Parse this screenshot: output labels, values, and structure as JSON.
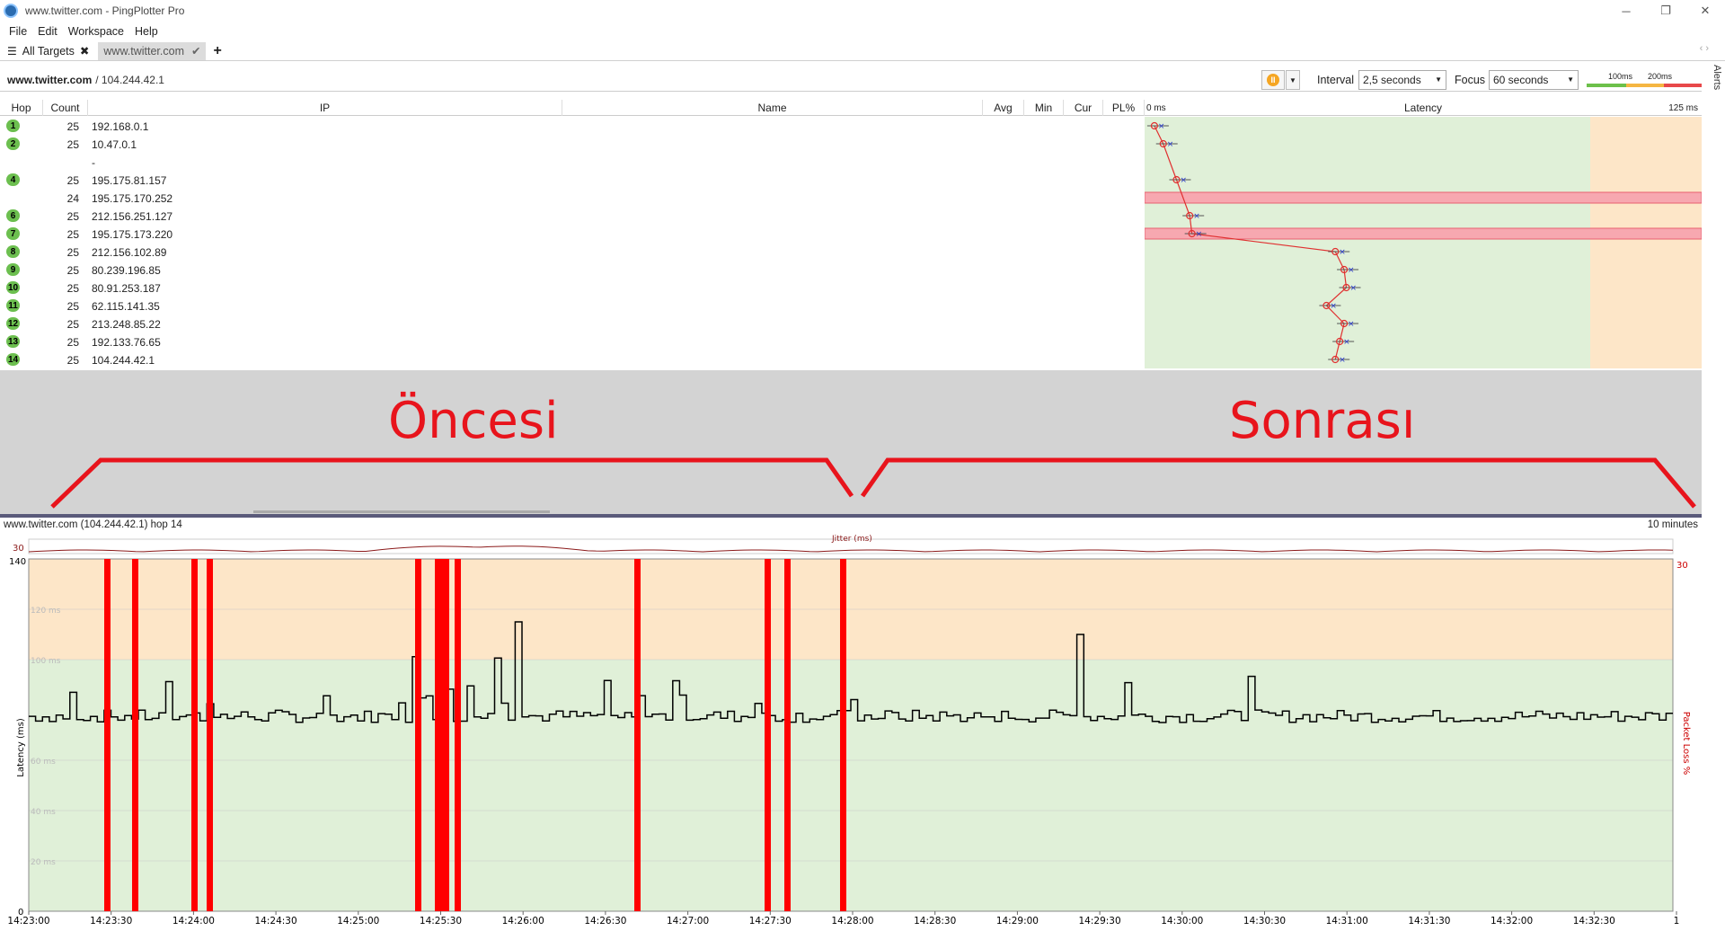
{
  "window": {
    "title": "www.twitter.com - PingPlotter Pro",
    "controls": [
      "─",
      "❐",
      "✕"
    ]
  },
  "menu": [
    "File",
    "Edit",
    "Workspace",
    "Help"
  ],
  "tabs": {
    "all_targets": "All Targets",
    "active": "www.twitter.com"
  },
  "toolbar": {
    "target_name": "www.twitter.com",
    "target_ip": "/ 104.244.42.1",
    "interval_label": "Interval",
    "interval_value": "2,5 seconds",
    "focus_label": "Focus",
    "focus_value": "60 seconds",
    "legend_100": "100ms",
    "legend_200": "200ms",
    "alerts": "Alerts"
  },
  "table": {
    "headers": [
      "Hop",
      "Count",
      "IP",
      "Name",
      "Avg",
      "Min",
      "Cur",
      "PL%"
    ],
    "latency_header": "Latency",
    "latency_min": "0 ms",
    "latency_max": "125 ms",
    "rows": [
      {
        "hop": "1",
        "count": "25",
        "ip": "192.168.0.1"
      },
      {
        "hop": "2",
        "count": "25",
        "ip": "10.47.0.1"
      },
      {
        "hop": "",
        "count": "",
        "ip": "-"
      },
      {
        "hop": "4",
        "count": "25",
        "ip": "195.175.81.157"
      },
      {
        "hop": "",
        "count": "24",
        "ip": "195.175.170.252"
      },
      {
        "hop": "6",
        "count": "25",
        "ip": "212.156.251.127"
      },
      {
        "hop": "7",
        "count": "25",
        "ip": "195.175.173.220"
      },
      {
        "hop": "8",
        "count": "25",
        "ip": "212.156.102.89"
      },
      {
        "hop": "9",
        "count": "25",
        "ip": "80.239.196.85"
      },
      {
        "hop": "10",
        "count": "25",
        "ip": "80.91.253.187"
      },
      {
        "hop": "11",
        "count": "25",
        "ip": "62.115.141.35"
      },
      {
        "hop": "12",
        "count": "25",
        "ip": "213.248.85.22"
      },
      {
        "hop": "13",
        "count": "25",
        "ip": "192.133.76.65"
      },
      {
        "hop": "14",
        "count": "25",
        "ip": "104.244.42.1"
      },
      {
        "hop": "",
        "count": "25",
        "ip": ""
      }
    ],
    "hop_latency_ms": [
      1,
      3,
      null,
      6,
      null,
      9,
      9.5,
      42,
      44,
      44.5,
      40,
      44,
      43,
      42
    ],
    "hop_lossy_rows": [
      4,
      6
    ]
  },
  "annotations": {
    "before": "Öncesi",
    "after": "Sonrası"
  },
  "graph": {
    "title": "www.twitter.com (104.244.42.1) hop 14",
    "range": "10 minutes",
    "jitter_label": "Jitter (ms)",
    "jitter_max": "30",
    "y_axis_label": "Latency (ms)",
    "y2_axis_label": "Packet Loss %",
    "y_max": "140",
    "y_min": "0",
    "y2_max": "30",
    "grid_labels": [
      "120 ms",
      "100 ms",
      "60 ms",
      "40 ms",
      "20 ms"
    ],
    "x_labels": [
      "14:23:00",
      "14:23:30",
      "14:24:00",
      "14:24:30",
      "14:25:00",
      "14:25:30",
      "14:26:00",
      "14:26:30",
      "14:27:00",
      "14:27:30",
      "14:28:00",
      "14:28:30",
      "14:29:00",
      "14:29:30",
      "14:30:00",
      "14:30:30",
      "14:31:00",
      "14:31:30",
      "14:32:00",
      "14:32:30",
      "1"
    ],
    "colors": {
      "warn": "#fde6c8",
      "ok": "#e0f0d8",
      "loss": "#ff0000",
      "line": "#000000",
      "jitter": "#8b1a1a"
    }
  }
}
